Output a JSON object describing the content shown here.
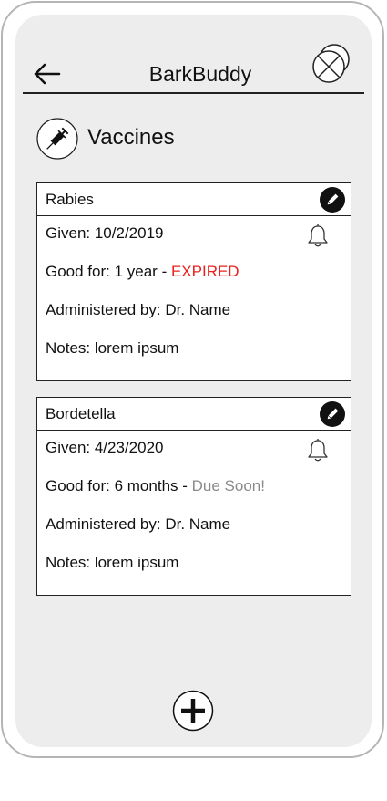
{
  "app": {
    "title": "BarkBuddy"
  },
  "header": {
    "back_icon": "arrow-left-icon",
    "menu_icon": "close-circle-icon"
  },
  "section": {
    "title": "Vaccines",
    "icon": "syringe-icon"
  },
  "vaccines": [
    {
      "name": "Rabies",
      "given": "Given: 10/2/2019",
      "good_for": "Good for: 1 year - ",
      "status": "EXPIRED",
      "status_color": "#e8201c",
      "administered_by": "Administered by: Dr. Name",
      "notes": "Notes: lorem ipsum"
    },
    {
      "name": "Bordetella",
      "given": "Given: 4/23/2020",
      "good_for": "Good for: 6 months - ",
      "status": "Due Soon!",
      "status_color": "#8a8a8a",
      "administered_by": "Administered by: Dr. Name",
      "notes": "Notes: lorem ipsum"
    }
  ],
  "footer": {
    "add_icon": "plus-circle-icon"
  }
}
